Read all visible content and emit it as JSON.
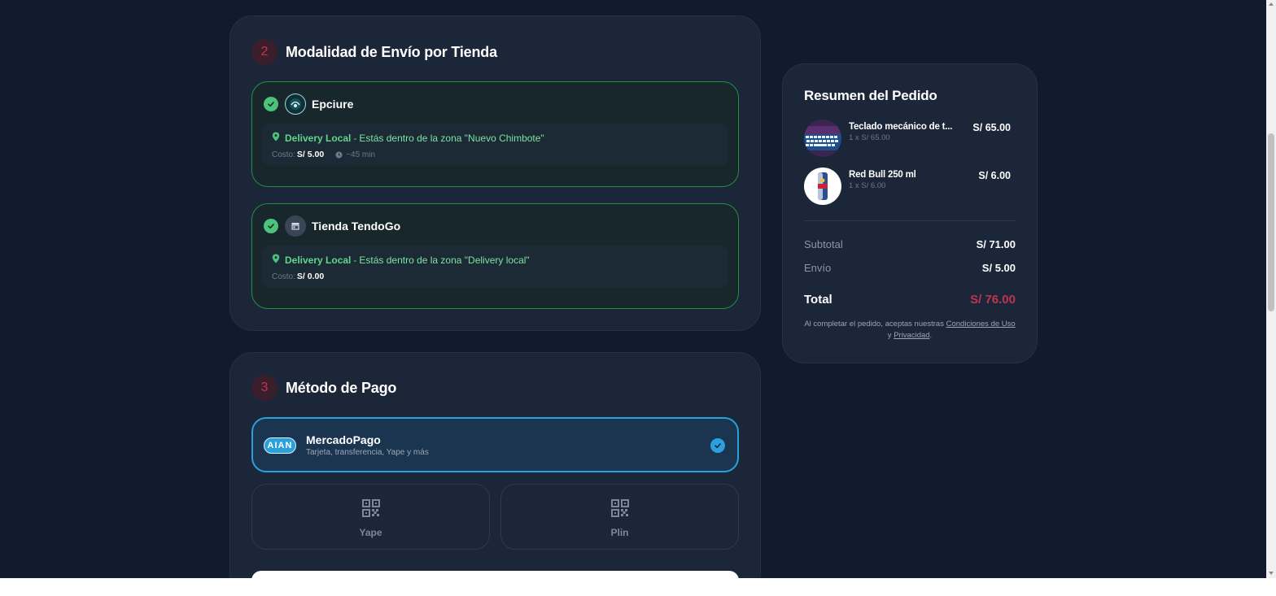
{
  "shipping": {
    "step": "2",
    "title": "Modalidad de Envío por Tienda",
    "stores": [
      {
        "name": "Epciure",
        "delivery_type": "Delivery Local",
        "separator": "-",
        "delivery_zone_text": "Estás dentro de la zona \"Nuevo Chimbote\"",
        "cost_label": "Costo:",
        "cost_value": "S/ 5.00",
        "eta": "~45 min"
      },
      {
        "name": "Tienda TendoGo",
        "delivery_type": "Delivery Local",
        "separator": "-",
        "delivery_zone_text": "Estás dentro de la zona \"Delivery local\"",
        "cost_label": "Costo:",
        "cost_value": "S/ 0.00"
      }
    ]
  },
  "payment": {
    "step": "3",
    "title": "Método de Pago",
    "mercadopago": {
      "logo_text": "AIAN",
      "name": "MercadoPago",
      "description": "Tarjeta, transferencia, Yape y más"
    },
    "options": [
      {
        "label": "Yape",
        "icon": "qr-code-icon"
      },
      {
        "label": "Plin",
        "icon": "qr-code-icon"
      }
    ]
  },
  "summary": {
    "title": "Resumen del Pedido",
    "items": [
      {
        "name": "Teclado mecánico de t...",
        "qty": "1 x S/ 65.00",
        "price": "S/ 65.00"
      },
      {
        "name": "Red Bull 250 ml",
        "qty": "1 x S/ 6.00",
        "price": "S/ 6.00"
      }
    ],
    "subtotal_label": "Subtotal",
    "subtotal_value": "S/ 71.00",
    "shipping_label": "Envío",
    "shipping_value": "S/ 5.00",
    "total_label": "Total",
    "total_value": "S/ 76.00",
    "legal_prefix": "Al completar el pedido, aceptas nuestras",
    "terms_link": "Condiciones de Uso",
    "legal_and": "y",
    "privacy_link": "Privacidad",
    "legal_suffix": "."
  },
  "colors": {
    "background": "#111a2e",
    "card": "#1b2638",
    "accent_green": "#4cc27a",
    "accent_blue": "#2aa0dc",
    "accent_red": "#c2334f"
  }
}
